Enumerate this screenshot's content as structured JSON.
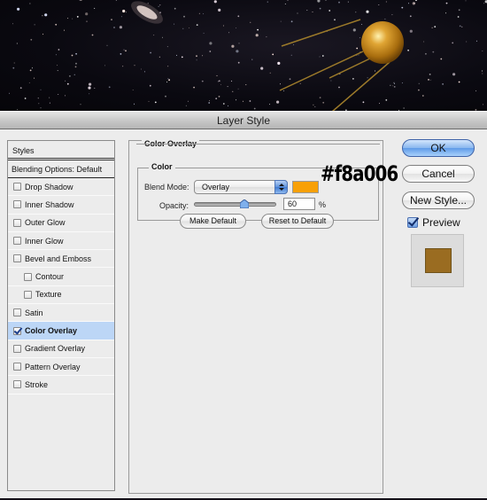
{
  "window": {
    "title": "Layer Style"
  },
  "styles_panel": {
    "header": "Styles",
    "blending_options": "Blending Options: Default",
    "items": [
      {
        "label": "Drop Shadow",
        "checked": false,
        "indent": false,
        "selected": false
      },
      {
        "label": "Inner Shadow",
        "checked": false,
        "indent": false,
        "selected": false
      },
      {
        "label": "Outer Glow",
        "checked": false,
        "indent": false,
        "selected": false
      },
      {
        "label": "Inner Glow",
        "checked": false,
        "indent": false,
        "selected": false
      },
      {
        "label": "Bevel and Emboss",
        "checked": false,
        "indent": false,
        "selected": false
      },
      {
        "label": "Contour",
        "checked": false,
        "indent": true,
        "selected": false
      },
      {
        "label": "Texture",
        "checked": false,
        "indent": true,
        "selected": false
      },
      {
        "label": "Satin",
        "checked": false,
        "indent": false,
        "selected": false
      },
      {
        "label": "Color Overlay",
        "checked": true,
        "indent": false,
        "selected": true
      },
      {
        "label": "Gradient Overlay",
        "checked": false,
        "indent": false,
        "selected": false
      },
      {
        "label": "Pattern Overlay",
        "checked": false,
        "indent": false,
        "selected": false
      },
      {
        "label": "Stroke",
        "checked": false,
        "indent": false,
        "selected": false
      }
    ]
  },
  "color_overlay": {
    "section_title": "Color Overlay",
    "group_title": "Color",
    "blend_mode_label": "Blend Mode:",
    "blend_mode_value": "Overlay",
    "color_hex": "#f8a006",
    "hex_annotation": "#f8a006",
    "opacity_label": "Opacity:",
    "opacity_value": "60",
    "opacity_unit": "%",
    "opacity_fraction": 0.6,
    "make_default": "Make Default",
    "reset_default": "Reset to Default"
  },
  "buttons": {
    "ok": "OK",
    "cancel": "Cancel",
    "new_style": "New Style..."
  },
  "preview": {
    "label": "Preview",
    "checked": true,
    "swatch_color": "#9a6c21"
  }
}
